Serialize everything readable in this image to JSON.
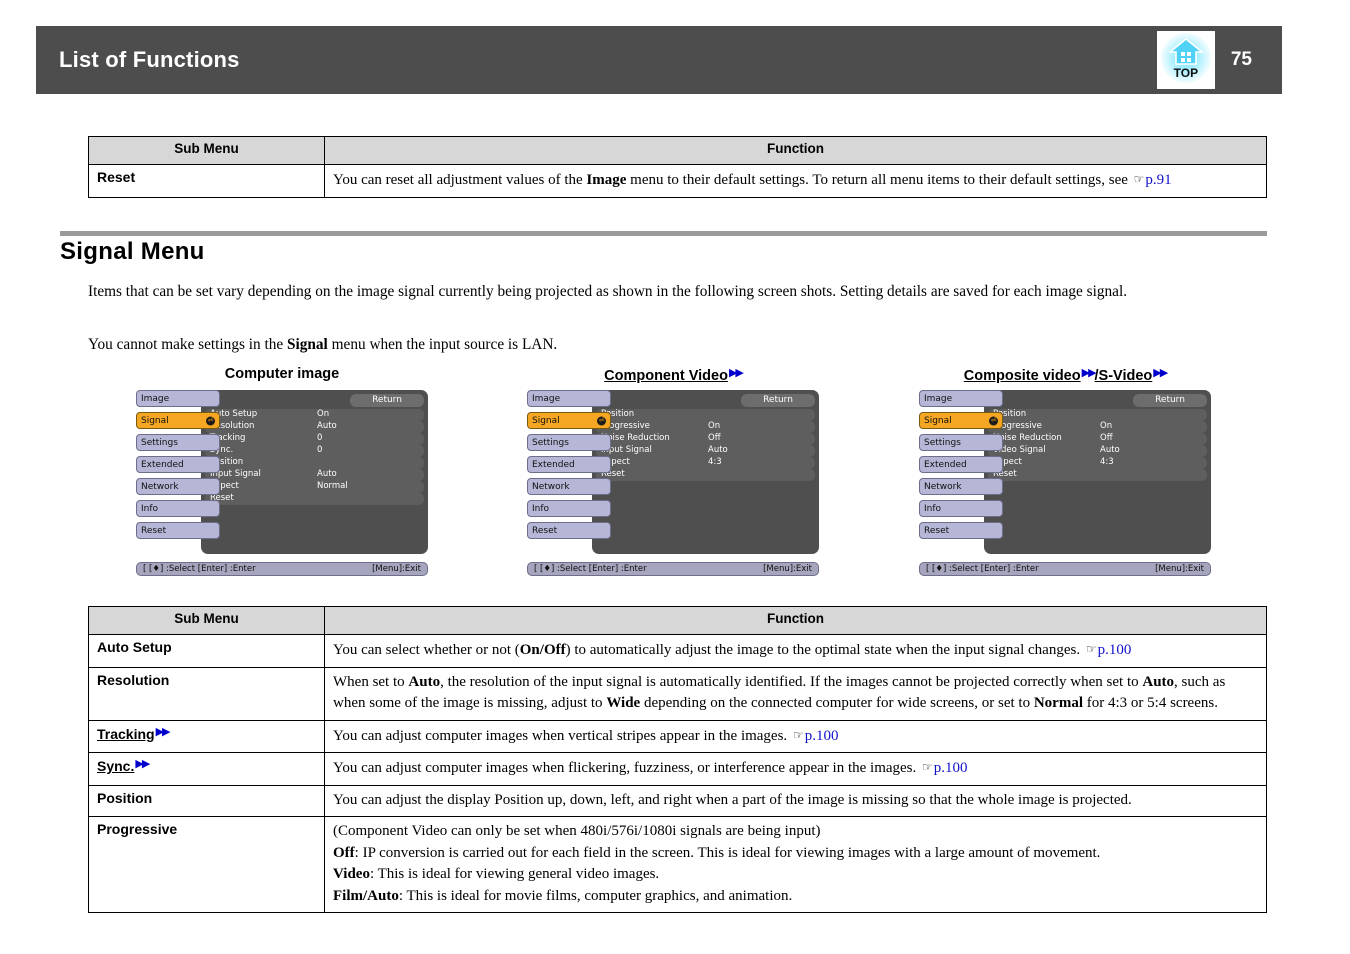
{
  "header": {
    "title": "List of Functions",
    "page_number": "75",
    "top_icon_label": "TOP"
  },
  "reset_table": {
    "headers": {
      "sub_menu": "Sub Menu",
      "function": "Function"
    },
    "rows": [
      {
        "sub_menu": "Reset",
        "text_before": "You can reset all adjustment values of the ",
        "bold1": "Image",
        "text_mid": " menu to their default settings. To return all menu items to their default settings, see ",
        "link": "p.91"
      }
    ]
  },
  "section": {
    "title": "Signal Menu",
    "paragraph1": "Items that can be set vary depending on the image signal currently being projected as shown in the following screen shots. Setting details are saved for each image signal.",
    "paragraph2_a": "You cannot make settings in the ",
    "paragraph2_b": "Signal",
    "paragraph2_c": " menu when the input source is LAN."
  },
  "screenshots": [
    {
      "caption": "Computer image",
      "caption_glossary": false,
      "sidebar": [
        {
          "label": "Image",
          "active": false
        },
        {
          "label": "Signal",
          "active": true
        },
        {
          "label": "Settings",
          "active": false
        },
        {
          "label": "Extended",
          "active": false
        },
        {
          "label": "Network",
          "active": false
        },
        {
          "label": "Info",
          "active": false
        },
        {
          "label": "Reset",
          "active": false
        }
      ],
      "return_label": "Return",
      "rows": [
        {
          "label": "Auto Setup",
          "value": "On"
        },
        {
          "label": "Resolution",
          "value": "Auto"
        },
        {
          "label": "Tracking",
          "value": "0"
        },
        {
          "label": "Sync.",
          "value": "0"
        },
        {
          "label": "Position",
          "value": ""
        },
        {
          "label": "Input Signal",
          "value": "Auto"
        },
        {
          "label": "Aspect",
          "value": "Normal"
        },
        {
          "label": "Reset",
          "value": ""
        }
      ],
      "footer_left": "[ [♦] :Select  [Enter] :Enter",
      "footer_right": "[Menu]:Exit"
    },
    {
      "caption": "Component Video",
      "caption_glossary": true,
      "sidebar": [
        {
          "label": "Image",
          "active": false
        },
        {
          "label": "Signal",
          "active": true
        },
        {
          "label": "Settings",
          "active": false
        },
        {
          "label": "Extended",
          "active": false
        },
        {
          "label": "Network",
          "active": false
        },
        {
          "label": "Info",
          "active": false
        },
        {
          "label": "Reset",
          "active": false
        }
      ],
      "return_label": "Return",
      "rows": [
        {
          "label": "Position",
          "value": ""
        },
        {
          "label": "Progressive",
          "value": "On"
        },
        {
          "label": "Noise Reduction",
          "value": "Off"
        },
        {
          "label": "Input Signal",
          "value": "Auto"
        },
        {
          "label": "Aspect",
          "value": "4:3"
        },
        {
          "label": "Reset",
          "value": ""
        }
      ],
      "footer_left": "[ [♦] :Select  [Enter] :Enter",
      "footer_right": "[Menu]:Exit"
    },
    {
      "caption": "Composite video",
      "caption2": "/S-Video",
      "caption_glossary": true,
      "sidebar": [
        {
          "label": "Image",
          "active": false
        },
        {
          "label": "Signal",
          "active": true
        },
        {
          "label": "Settings",
          "active": false
        },
        {
          "label": "Extended",
          "active": false
        },
        {
          "label": "Network",
          "active": false
        },
        {
          "label": "Info",
          "active": false
        },
        {
          "label": "Reset",
          "active": false
        }
      ],
      "return_label": "Return",
      "rows": [
        {
          "label": "Position",
          "value": ""
        },
        {
          "label": "Progressive",
          "value": "On"
        },
        {
          "label": "Noise Reduction",
          "value": "Off"
        },
        {
          "label": "Video Signal",
          "value": "Auto"
        },
        {
          "label": "Aspect",
          "value": "4:3"
        },
        {
          "label": "Reset",
          "value": ""
        }
      ],
      "footer_left": "[ [♦] :Select  [Enter] :Enter",
      "footer_right": "[Menu]:Exit"
    }
  ],
  "signal_table": {
    "headers": {
      "sub_menu": "Sub Menu",
      "function": "Function"
    },
    "rows": {
      "auto_setup": {
        "label": "Auto Setup",
        "t1": "You can select whether or not (",
        "b1": "On/Off",
        "t2": ") to automatically adjust the image to the optimal state when the input signal changes. ",
        "link": "p.100"
      },
      "resolution": {
        "label": "Resolution",
        "t1": "When set to ",
        "b1": "Auto",
        "t2": ", the resolution of the input signal is automatically identified. If the images cannot be projected correctly when set to ",
        "b2": "Auto",
        "t3": ", such as when some of the image is missing, adjust to ",
        "b3": "Wide",
        "t4": " depending on the connected computer for wide screens, or set to ",
        "b4": "Normal",
        "t5": " for 4:3 or 5:4 screens."
      },
      "tracking": {
        "label": "Tracking",
        "t1": "You can adjust computer images when vertical stripes appear in the images. ",
        "link": "p.100"
      },
      "sync": {
        "label": "Sync.",
        "t1": "You can adjust computer images when flickering, fuzziness, or interference appear in the images. ",
        "link": "p.100"
      },
      "position": {
        "label": "Position",
        "t1": "You can adjust the display Position up, down, left, and right when a part of the image is missing so that the whole image is projected."
      },
      "progressive": {
        "label": "Progressive",
        "line1": "(Component Video can only be set when 480i/576i/1080i signals are being input)",
        "line2_b": "Off",
        "line2_t": ": IP conversion is carried out for each field in the screen. This is ideal for viewing images with a large amount of movement.",
        "line3_b": "Video",
        "line3_t": ": This is ideal for viewing general video images.",
        "line4_b": "Film/Auto",
        "line4_t": ": This is ideal for movie films, computer graphics, and animation."
      }
    }
  },
  "colors": {
    "header_bg": "#4d4d4d",
    "table_header_bg": "#d7d7d7",
    "link_blue": "#1111cc",
    "osd_highlight": "#f5a623",
    "osd_sidebar": "#b6b6d6"
  }
}
